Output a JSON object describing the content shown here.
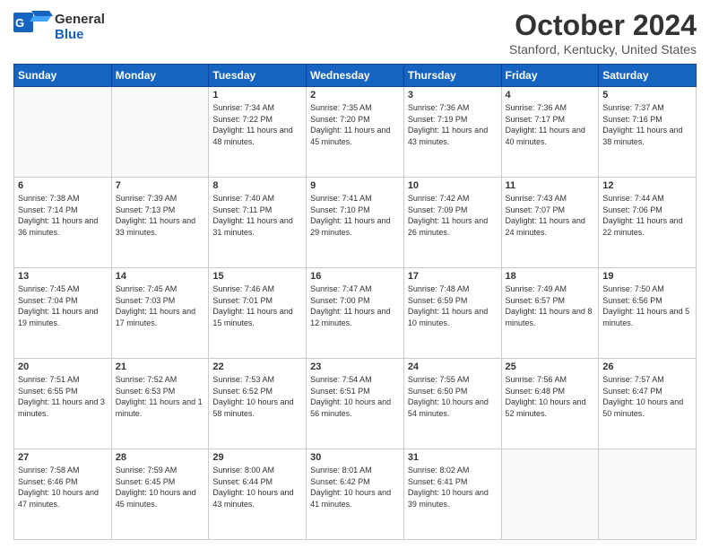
{
  "header": {
    "logo_general": "General",
    "logo_blue": "Blue",
    "month": "October 2024",
    "location": "Stanford, Kentucky, United States"
  },
  "days_of_week": [
    "Sunday",
    "Monday",
    "Tuesday",
    "Wednesday",
    "Thursday",
    "Friday",
    "Saturday"
  ],
  "weeks": [
    [
      {
        "day": "",
        "info": ""
      },
      {
        "day": "",
        "info": ""
      },
      {
        "day": "1",
        "info": "Sunrise: 7:34 AM\nSunset: 7:22 PM\nDaylight: 11 hours and 48 minutes."
      },
      {
        "day": "2",
        "info": "Sunrise: 7:35 AM\nSunset: 7:20 PM\nDaylight: 11 hours and 45 minutes."
      },
      {
        "day": "3",
        "info": "Sunrise: 7:36 AM\nSunset: 7:19 PM\nDaylight: 11 hours and 43 minutes."
      },
      {
        "day": "4",
        "info": "Sunrise: 7:36 AM\nSunset: 7:17 PM\nDaylight: 11 hours and 40 minutes."
      },
      {
        "day": "5",
        "info": "Sunrise: 7:37 AM\nSunset: 7:16 PM\nDaylight: 11 hours and 38 minutes."
      }
    ],
    [
      {
        "day": "6",
        "info": "Sunrise: 7:38 AM\nSunset: 7:14 PM\nDaylight: 11 hours and 36 minutes."
      },
      {
        "day": "7",
        "info": "Sunrise: 7:39 AM\nSunset: 7:13 PM\nDaylight: 11 hours and 33 minutes."
      },
      {
        "day": "8",
        "info": "Sunrise: 7:40 AM\nSunset: 7:11 PM\nDaylight: 11 hours and 31 minutes."
      },
      {
        "day": "9",
        "info": "Sunrise: 7:41 AM\nSunset: 7:10 PM\nDaylight: 11 hours and 29 minutes."
      },
      {
        "day": "10",
        "info": "Sunrise: 7:42 AM\nSunset: 7:09 PM\nDaylight: 11 hours and 26 minutes."
      },
      {
        "day": "11",
        "info": "Sunrise: 7:43 AM\nSunset: 7:07 PM\nDaylight: 11 hours and 24 minutes."
      },
      {
        "day": "12",
        "info": "Sunrise: 7:44 AM\nSunset: 7:06 PM\nDaylight: 11 hours and 22 minutes."
      }
    ],
    [
      {
        "day": "13",
        "info": "Sunrise: 7:45 AM\nSunset: 7:04 PM\nDaylight: 11 hours and 19 minutes."
      },
      {
        "day": "14",
        "info": "Sunrise: 7:45 AM\nSunset: 7:03 PM\nDaylight: 11 hours and 17 minutes."
      },
      {
        "day": "15",
        "info": "Sunrise: 7:46 AM\nSunset: 7:01 PM\nDaylight: 11 hours and 15 minutes."
      },
      {
        "day": "16",
        "info": "Sunrise: 7:47 AM\nSunset: 7:00 PM\nDaylight: 11 hours and 12 minutes."
      },
      {
        "day": "17",
        "info": "Sunrise: 7:48 AM\nSunset: 6:59 PM\nDaylight: 11 hours and 10 minutes."
      },
      {
        "day": "18",
        "info": "Sunrise: 7:49 AM\nSunset: 6:57 PM\nDaylight: 11 hours and 8 minutes."
      },
      {
        "day": "19",
        "info": "Sunrise: 7:50 AM\nSunset: 6:56 PM\nDaylight: 11 hours and 5 minutes."
      }
    ],
    [
      {
        "day": "20",
        "info": "Sunrise: 7:51 AM\nSunset: 6:55 PM\nDaylight: 11 hours and 3 minutes."
      },
      {
        "day": "21",
        "info": "Sunrise: 7:52 AM\nSunset: 6:53 PM\nDaylight: 11 hours and 1 minute."
      },
      {
        "day": "22",
        "info": "Sunrise: 7:53 AM\nSunset: 6:52 PM\nDaylight: 10 hours and 58 minutes."
      },
      {
        "day": "23",
        "info": "Sunrise: 7:54 AM\nSunset: 6:51 PM\nDaylight: 10 hours and 56 minutes."
      },
      {
        "day": "24",
        "info": "Sunrise: 7:55 AM\nSunset: 6:50 PM\nDaylight: 10 hours and 54 minutes."
      },
      {
        "day": "25",
        "info": "Sunrise: 7:56 AM\nSunset: 6:48 PM\nDaylight: 10 hours and 52 minutes."
      },
      {
        "day": "26",
        "info": "Sunrise: 7:57 AM\nSunset: 6:47 PM\nDaylight: 10 hours and 50 minutes."
      }
    ],
    [
      {
        "day": "27",
        "info": "Sunrise: 7:58 AM\nSunset: 6:46 PM\nDaylight: 10 hours and 47 minutes."
      },
      {
        "day": "28",
        "info": "Sunrise: 7:59 AM\nSunset: 6:45 PM\nDaylight: 10 hours and 45 minutes."
      },
      {
        "day": "29",
        "info": "Sunrise: 8:00 AM\nSunset: 6:44 PM\nDaylight: 10 hours and 43 minutes."
      },
      {
        "day": "30",
        "info": "Sunrise: 8:01 AM\nSunset: 6:42 PM\nDaylight: 10 hours and 41 minutes."
      },
      {
        "day": "31",
        "info": "Sunrise: 8:02 AM\nSunset: 6:41 PM\nDaylight: 10 hours and 39 minutes."
      },
      {
        "day": "",
        "info": ""
      },
      {
        "day": "",
        "info": ""
      }
    ]
  ]
}
